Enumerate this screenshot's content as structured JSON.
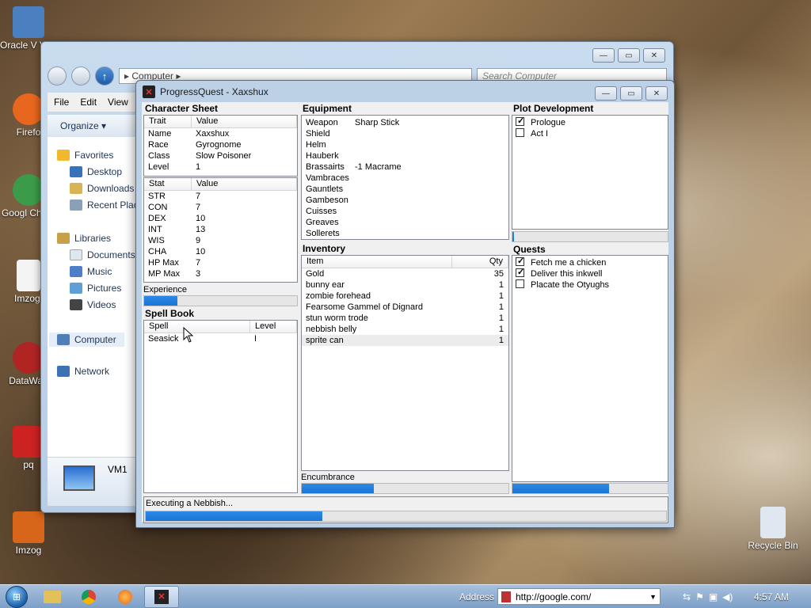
{
  "desktop": {
    "icons": [
      {
        "label": "Oracle V VirtualB",
        "color": "#4a7fc0"
      },
      {
        "label": "Firefo",
        "color": "#e8661d"
      },
      {
        "label": "Googl Chron",
        "color": "#3c9b4a"
      },
      {
        "label": "Imzog.",
        "color": "#f4f4f4"
      },
      {
        "label": "DataWag",
        "color": "#b02424"
      },
      {
        "label": "pq",
        "color": "#cc2222"
      },
      {
        "label": "Imzog",
        "color": "#d8661a"
      },
      {
        "label": "Recycle Bin",
        "color": "#dfe8f0"
      }
    ]
  },
  "explorer": {
    "address": "Computer",
    "search_placeholder": "Search Computer",
    "menu": [
      "File",
      "Edit",
      "View"
    ],
    "organize": "Organize ▾",
    "nav_items": [
      {
        "label": "Favorites",
        "icon": "star-icon"
      },
      {
        "label": "Desktop",
        "icon": "desktop-icon"
      },
      {
        "label": "Downloads",
        "icon": "downloads-folder-icon"
      },
      {
        "label": "Recent Plac",
        "icon": "recent-places-icon"
      },
      {
        "label": "Libraries",
        "icon": "libraries-icon"
      },
      {
        "label": "Documents",
        "icon": "documents-icon"
      },
      {
        "label": "Music",
        "icon": "music-icon"
      },
      {
        "label": "Pictures",
        "icon": "pictures-icon"
      },
      {
        "label": "Videos",
        "icon": "videos-icon"
      },
      {
        "label": "Computer",
        "icon": "computer-icon"
      },
      {
        "label": "Network",
        "icon": "network-icon"
      }
    ],
    "details_name": "VM1"
  },
  "pq": {
    "title": "ProgressQuest - Xaxshux",
    "character_sheet": {
      "header": "Character Sheet",
      "trait_cols": [
        "Trait",
        "Value"
      ],
      "traits": [
        [
          "Name",
          "Xaxshux"
        ],
        [
          "Race",
          "Gyrognome"
        ],
        [
          "Class",
          "Slow Poisoner"
        ],
        [
          "Level",
          "1"
        ]
      ],
      "stat_cols": [
        "Stat",
        "Value"
      ],
      "stats": [
        [
          "STR",
          "7"
        ],
        [
          "CON",
          "7"
        ],
        [
          "DEX",
          "10"
        ],
        [
          "INT",
          "13"
        ],
        [
          "WIS",
          "9"
        ],
        [
          "CHA",
          "10"
        ],
        [
          "HP Max",
          "7"
        ],
        [
          "MP Max",
          "3"
        ]
      ],
      "experience_label": "Experience",
      "experience_progress": 0.22
    },
    "spell_book": {
      "header": "Spell Book",
      "cols": [
        "Spell",
        "Level"
      ],
      "spells": [
        [
          "Seasick",
          "I"
        ]
      ]
    },
    "equipment": {
      "header": "Equipment",
      "items": [
        [
          "Weapon",
          "Sharp Stick"
        ],
        [
          "Shield",
          ""
        ],
        [
          "Helm",
          ""
        ],
        [
          "Hauberk",
          ""
        ],
        [
          "Brassairts",
          "-1 Macrame"
        ],
        [
          "Vambraces",
          ""
        ],
        [
          "Gauntlets",
          ""
        ],
        [
          "Gambeson",
          ""
        ],
        [
          "Cuisses",
          ""
        ],
        [
          "Greaves",
          ""
        ],
        [
          "Sollerets",
          ""
        ]
      ]
    },
    "inventory": {
      "header": "Inventory",
      "cols": [
        "Item",
        "Qty"
      ],
      "items": [
        [
          "Gold",
          "35"
        ],
        [
          "bunny ear",
          "1"
        ],
        [
          "zombie forehead",
          "1"
        ],
        [
          "Fearsome Gammel of Dignard",
          "1"
        ],
        [
          "stun worm trode",
          "1"
        ],
        [
          "nebbish belly",
          "1"
        ],
        [
          "sprite can",
          "1"
        ]
      ],
      "encumbrance_label": "Encumbrance",
      "encumbrance_progress": 0.35
    },
    "plot": {
      "header": "Plot Development",
      "acts": [
        {
          "label": "Prologue",
          "checked": true
        },
        {
          "label": "Act I",
          "checked": false
        }
      ],
      "progress": 0.01
    },
    "quests": {
      "header": "Quests",
      "items": [
        {
          "label": "Fetch me a chicken",
          "checked": true
        },
        {
          "label": "Deliver this inkwell",
          "checked": true
        },
        {
          "label": "Placate the Otyughs",
          "checked": false
        }
      ],
      "progress": 0.62
    },
    "status": "Executing a Nebbish...",
    "status_progress": 0.34
  },
  "taskbar": {
    "address_label": "Address",
    "address_value": "http://google.com/",
    "clock": "4:57 AM"
  }
}
